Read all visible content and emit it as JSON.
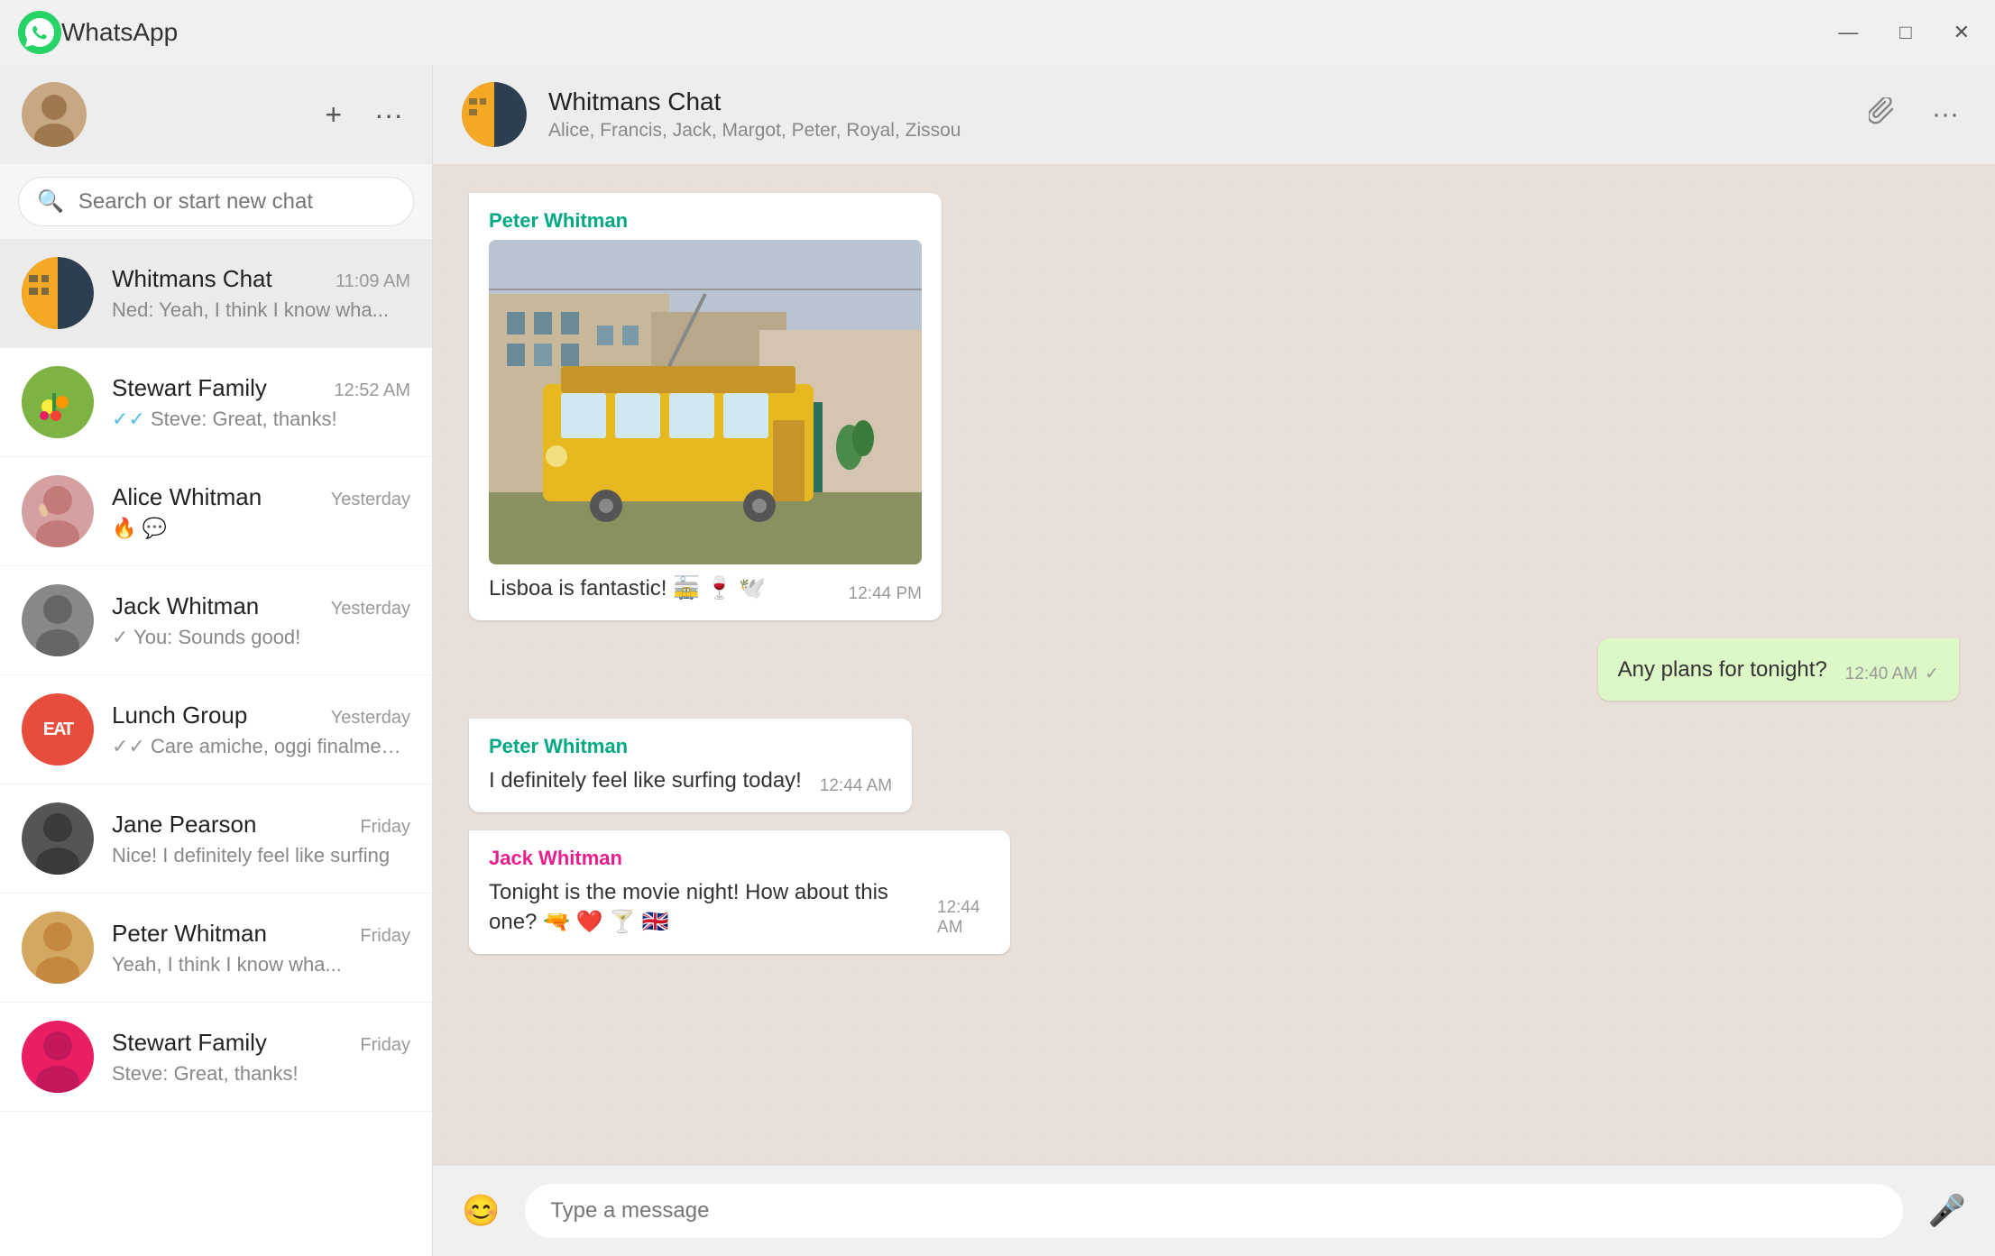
{
  "titlebar": {
    "title": "WhatsApp",
    "minimize": "—",
    "maximize": "□",
    "close": "✕"
  },
  "sidebar": {
    "search_placeholder": "Search or start new chat",
    "new_chat_btn": "+",
    "menu_btn": "···",
    "chats": [
      {
        "id": "whitmans-chat",
        "name": "Whitmans Chat",
        "time": "11:09 AM",
        "preview": "Ned: Yeah, I think I know wha...",
        "avatar_type": "group_split",
        "active": true
      },
      {
        "id": "stewart-family",
        "name": "Stewart Family",
        "time": "12:52 AM",
        "preview": "Steve: Great, thanks!",
        "avatar_type": "flowers",
        "tick": "double_blue"
      },
      {
        "id": "alice-whitman",
        "name": "Alice Whitman",
        "time": "Yesterday",
        "preview": "🔥 💬",
        "avatar_type": "alice"
      },
      {
        "id": "jack-whitman",
        "name": "Jack Whitman",
        "time": "Yesterday",
        "preview": "You: Sounds good!",
        "avatar_type": "jack",
        "tick": "single_grey"
      },
      {
        "id": "lunch-group",
        "name": "Lunch Group",
        "time": "Yesterday",
        "preview": "Care amiche, oggi finalmente posso",
        "avatar_type": "eat",
        "tick": "double_grey"
      },
      {
        "id": "jane-pearson",
        "name": "Jane Pearson",
        "time": "Friday",
        "preview": "Nice! I definitely feel like surfing",
        "avatar_type": "jane"
      },
      {
        "id": "peter-whitman",
        "name": "Peter Whitman",
        "time": "Friday",
        "preview": "Yeah, I think I know wha...",
        "avatar_type": "peter"
      },
      {
        "id": "stewart-family-2",
        "name": "Stewart Family",
        "time": "Friday",
        "preview": "Steve: Great, thanks!",
        "avatar_type": "flowers2"
      }
    ]
  },
  "chat_header": {
    "name": "Whitmans Chat",
    "members": "Alice, Francis, Jack, Margot, Peter, Royal, Zissou",
    "paperclip_btn": "📎",
    "menu_btn": "···"
  },
  "messages": [
    {
      "id": "msg1",
      "type": "incoming",
      "sender": "Peter Whitman",
      "sender_color": "peter",
      "has_image": true,
      "text": "Lisboa is fantastic! 🚋 🍷 🕊️",
      "time": "12:44 PM",
      "tick": ""
    },
    {
      "id": "msg2",
      "type": "outgoing",
      "sender": "",
      "sender_color": "",
      "has_image": false,
      "text": "Any plans for tonight?",
      "time": "12:40 AM",
      "tick": "✓"
    },
    {
      "id": "msg3",
      "type": "incoming",
      "sender": "Peter Whitman",
      "sender_color": "peter",
      "has_image": false,
      "text": "I definitely feel like surfing today!",
      "time": "12:44 AM",
      "tick": ""
    },
    {
      "id": "msg4",
      "type": "incoming",
      "sender": "Jack Whitman",
      "sender_color": "jack",
      "has_image": false,
      "text": "Tonight is the movie night! How about this one? 🔫 ❤️ 🍸 🇬🇧",
      "time": "12:44 AM",
      "tick": ""
    }
  ],
  "input_bar": {
    "emoji_btn": "😊",
    "placeholder": "Type a message",
    "mic_btn": "🎤"
  }
}
